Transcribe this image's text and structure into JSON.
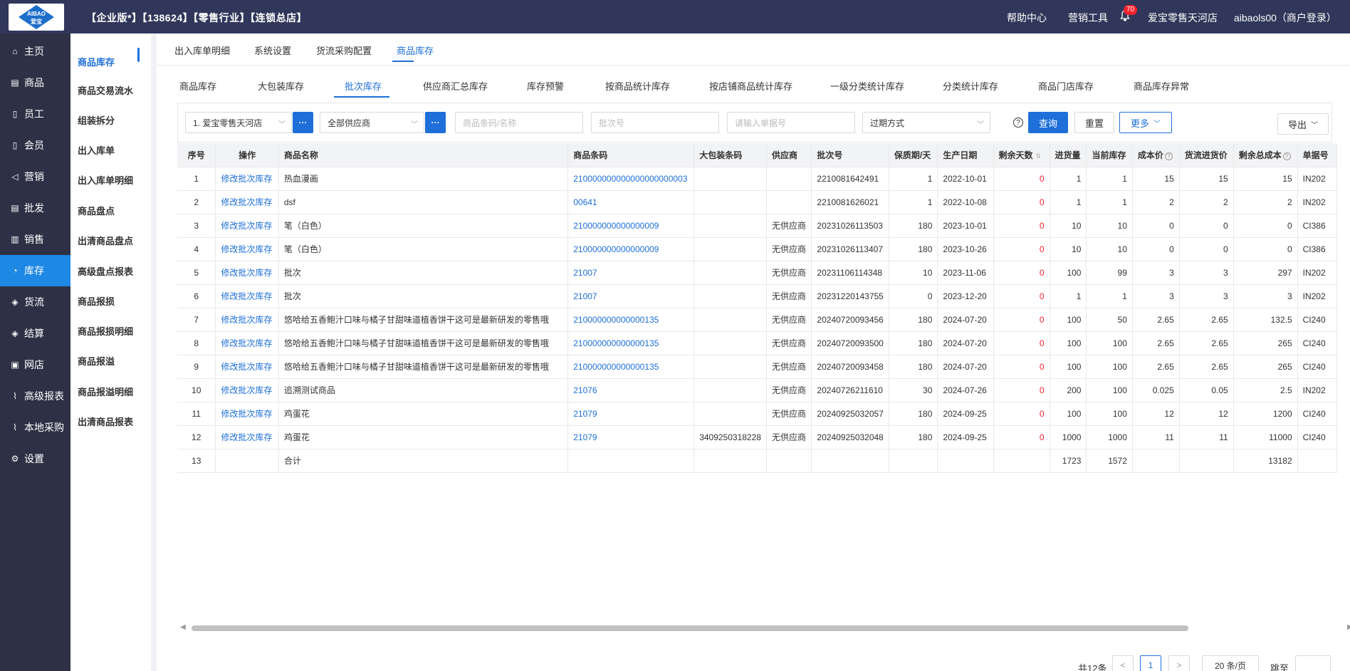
{
  "header": {
    "logo_text_top": "AIBAO",
    "logo_text_bottom": "爱宝",
    "title": "【企业版*】【138624】【零售行业】【连锁总店】",
    "help": "帮助中心",
    "marketing_tools": "营销工具",
    "notification_count": "70",
    "store": "爱宝零售天河店",
    "user": "aibaols00（商户登录）"
  },
  "nav": {
    "items": [
      {
        "label": "主页",
        "icon": "home-icon",
        "glyph": "⌂"
      },
      {
        "label": "商品",
        "icon": "product-icon",
        "glyph": "▤"
      },
      {
        "label": "员工",
        "icon": "staff-icon",
        "glyph": "▯"
      },
      {
        "label": "会员",
        "icon": "member-icon",
        "glyph": "▯"
      },
      {
        "label": "营销",
        "icon": "megaphone-icon",
        "glyph": "◁"
      },
      {
        "label": "批发",
        "icon": "wholesale-icon",
        "glyph": "▤"
      },
      {
        "label": "销售",
        "icon": "chart-icon",
        "glyph": "▥"
      },
      {
        "label": "库存",
        "icon": "stock-icon",
        "glyph": "◔"
      },
      {
        "label": "货流",
        "icon": "flow-icon",
        "glyph": "◈"
      },
      {
        "label": "结算",
        "icon": "settle-icon",
        "glyph": "◈"
      },
      {
        "label": "网店",
        "icon": "shop-icon",
        "glyph": "▣"
      },
      {
        "label": "高级报表",
        "icon": "report-icon",
        "glyph": "⌇"
      },
      {
        "label": "本地采购",
        "icon": "purchase-icon",
        "glyph": "⌇"
      },
      {
        "label": "设置",
        "icon": "gear-icon",
        "glyph": "⚙"
      }
    ]
  },
  "subnav": {
    "items": [
      "商品库存",
      "商品交易流水",
      "组装拆分",
      "出入库单",
      "出入库单明细",
      "商品盘点",
      "出清商品盘点",
      "高级盘点报表",
      "商品报损",
      "商品报损明细",
      "商品报溢",
      "商品报溢明细",
      "出清商品报表"
    ]
  },
  "tabs1": [
    "出入库单明细",
    "系统设置",
    "货流采购配置",
    "商品库存"
  ],
  "tabs2": [
    "商品库存",
    "大包装库存",
    "批次库存",
    "供应商汇总库存",
    "库存预警",
    "按商品统计库存",
    "按店铺商品统计库存",
    "一级分类统计库存",
    "分类统计库存",
    "商品门店库存",
    "商品库存异常"
  ],
  "filters": {
    "store": "1. 爱宝零售天河店",
    "supplier": "全部供应商",
    "barcode_placeholder": "商品条码/名称",
    "batch_placeholder": "批次号",
    "doc_placeholder": "请输入单据号",
    "expiry": "过期方式",
    "query": "查询",
    "reset": "重置",
    "more": "更多",
    "export": "导出",
    "dots": "···"
  },
  "table": {
    "headers": [
      "序号",
      "操作",
      "商品名称",
      "商品条码",
      "大包装条码",
      "供应商",
      "批次号",
      "保质期/天",
      "生产日期",
      "剩余天数",
      "进货量",
      "当前库存",
      "成本价",
      "货流进货价",
      "剩余总成本",
      "单据号"
    ],
    "rows": [
      [
        "1",
        "修改批次库存",
        "热血漫画",
        "210000000000000000000003",
        "",
        "",
        "2210081642491",
        "1",
        "2022-10-01",
        "0",
        "1",
        "1",
        "15",
        "15",
        "15",
        "IN202"
      ],
      [
        "2",
        "修改批次库存",
        "dsf",
        "00641",
        "",
        "",
        "2210081626021",
        "1",
        "2022-10-08",
        "0",
        "1",
        "1",
        "2",
        "2",
        "2",
        "IN202"
      ],
      [
        "3",
        "修改批次库存",
        "笔（白色）",
        "210000000000000009",
        "",
        "无供应商",
        "20231026113503",
        "180",
        "2023-10-01",
        "0",
        "10",
        "10",
        "0",
        "0",
        "0",
        "CI386"
      ],
      [
        "4",
        "修改批次库存",
        "笔（白色）",
        "210000000000000009",
        "",
        "无供应商",
        "20231026113407",
        "180",
        "2023-10-26",
        "0",
        "10",
        "10",
        "0",
        "0",
        "0",
        "CI386"
      ],
      [
        "5",
        "修改批次库存",
        "批次",
        "21007",
        "",
        "无供应商",
        "20231106114348",
        "10",
        "2023-11-06",
        "0",
        "100",
        "99",
        "3",
        "3",
        "297",
        "IN202"
      ],
      [
        "6",
        "修改批次库存",
        "批次",
        "21007",
        "",
        "无供应商",
        "20231220143755",
        "0",
        "2023-12-20",
        "0",
        "1",
        "1",
        "3",
        "3",
        "3",
        "IN202"
      ],
      [
        "7",
        "修改批次库存",
        "悠哈给五香鲍汁口味与橘子甘甜味道植香饼干这可是最新研发的零售哦",
        "210000000000000135",
        "",
        "无供应商",
        "20240720093456",
        "180",
        "2024-07-20",
        "0",
        "100",
        "50",
        "2.65",
        "2.65",
        "132.5",
        "CI240"
      ],
      [
        "8",
        "修改批次库存",
        "悠哈给五香鲍汁口味与橘子甘甜味道植香饼干这可是最新研发的零售哦",
        "210000000000000135",
        "",
        "无供应商",
        "20240720093500",
        "180",
        "2024-07-20",
        "0",
        "100",
        "100",
        "2.65",
        "2.65",
        "265",
        "CI240"
      ],
      [
        "9",
        "修改批次库存",
        "悠哈给五香鲍汁口味与橘子甘甜味道植香饼干这可是最新研发的零售哦",
        "210000000000000135",
        "",
        "无供应商",
        "20240720093458",
        "180",
        "2024-07-20",
        "0",
        "100",
        "100",
        "2.65",
        "2.65",
        "265",
        "CI240"
      ],
      [
        "10",
        "修改批次库存",
        "追溯测试商品",
        "21076",
        "",
        "无供应商",
        "20240726211610",
        "30",
        "2024-07-26",
        "0",
        "200",
        "100",
        "0.025",
        "0.05",
        "2.5",
        "IN202"
      ],
      [
        "11",
        "修改批次库存",
        "鸡蛋花",
        "21079",
        "",
        "无供应商",
        "20240925032057",
        "180",
        "2024-09-25",
        "0",
        "100",
        "100",
        "12",
        "12",
        "1200",
        "CI240"
      ],
      [
        "12",
        "修改批次库存",
        "鸡蛋花",
        "21079",
        "3409250318228",
        "无供应商",
        "20240925032048",
        "180",
        "2024-09-25",
        "0",
        "1000",
        "1000",
        "11",
        "11",
        "11000",
        "CI240"
      ],
      [
        "13",
        "",
        "合计",
        "",
        "",
        "",
        "",
        "",
        "",
        "",
        "1723",
        "1572",
        "",
        "",
        "13182",
        ""
      ]
    ]
  },
  "pagination": {
    "total": "共12条",
    "current": "1",
    "page_size": "20 条/页",
    "goto": "跳至"
  }
}
